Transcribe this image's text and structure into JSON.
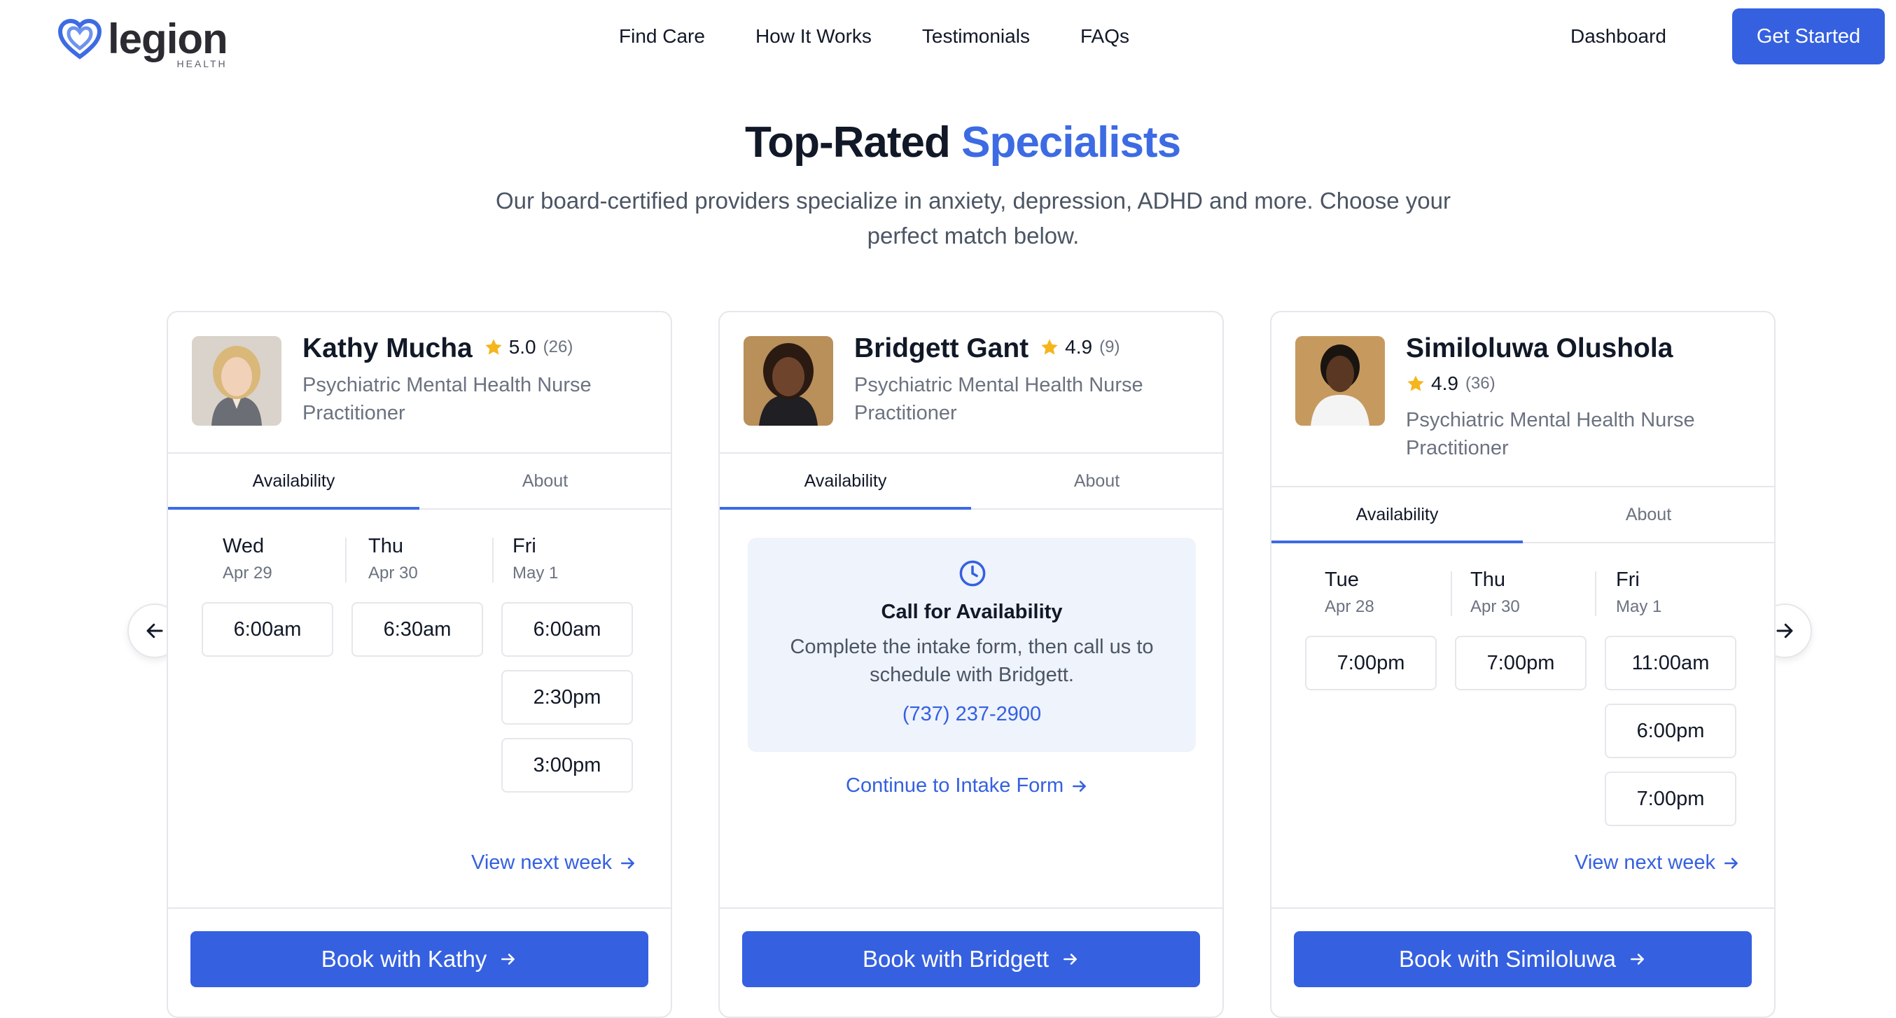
{
  "brand": {
    "name": "legion",
    "sub": "HEALTH"
  },
  "nav": {
    "items": [
      "Find Care",
      "How It Works",
      "Testimonials",
      "FAQs"
    ],
    "dashboard": "Dashboard",
    "cta": "Get Started"
  },
  "hero": {
    "title_part1": "Top-Rated ",
    "title_part2": "Specialists",
    "subtitle": "Our board-certified providers specialize in anxiety, depression, ADHD and more. Choose your perfect match below."
  },
  "colors": {
    "accent": "#3560e0",
    "star": "#f5b51c"
  },
  "icons": {
    "prev": "arrow-left-icon",
    "next": "arrow-right-icon",
    "star": "star-icon",
    "clock": "clock-icon"
  },
  "providers": [
    {
      "name": "Kathy Mucha",
      "rating": "5.0",
      "count": "(26)",
      "title": "Psychiatric Mental Health Nurse Practitioner",
      "tabs": [
        "Availability",
        "About"
      ],
      "days": [
        {
          "day": "Wed",
          "date": "Apr 29",
          "slots": [
            "6:00am"
          ]
        },
        {
          "day": "Thu",
          "date": "Apr 30",
          "slots": [
            "6:30am"
          ]
        },
        {
          "day": "Fri",
          "date": "May 1",
          "slots": [
            "6:00am",
            "2:30pm",
            "3:00pm"
          ]
        }
      ],
      "link": "View next week",
      "book": "Book with Kathy"
    },
    {
      "name": "Bridgett Gant",
      "rating": "4.9",
      "count": "(9)",
      "title": "Psychiatric Mental Health Nurse Practitioner",
      "tabs": [
        "Availability",
        "About"
      ],
      "call": {
        "title": "Call for Availability",
        "desc": "Complete the intake form, then call us to schedule with Bridgett.",
        "phone": "(737) 237-2900"
      },
      "link": "Continue to Intake Form",
      "book": "Book with Bridgett"
    },
    {
      "name": "Similoluwa Olushola",
      "rating": "4.9",
      "count": "(36)",
      "title": "Psychiatric Mental Health Nurse Practitioner",
      "tabs": [
        "Availability",
        "About"
      ],
      "days": [
        {
          "day": "Tue",
          "date": "Apr 28",
          "slots": [
            "7:00pm"
          ]
        },
        {
          "day": "Thu",
          "date": "Apr 30",
          "slots": [
            "7:00pm"
          ]
        },
        {
          "day": "Fri",
          "date": "May 1",
          "slots": [
            "11:00am",
            "6:00pm",
            "7:00pm"
          ]
        }
      ],
      "link": "View next week",
      "book": "Book with Similoluwa"
    }
  ]
}
